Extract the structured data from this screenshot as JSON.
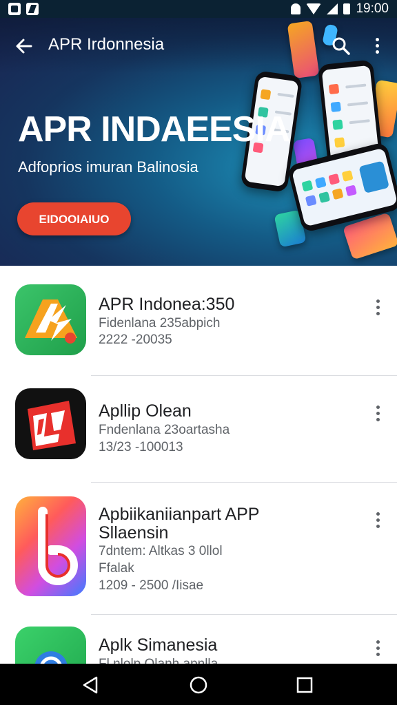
{
  "status_bar": {
    "time": "19:00"
  },
  "app_bar": {
    "title": "APR Irdonnesia"
  },
  "hero": {
    "title": "APR INDAEESIA",
    "subtitle": "Adfoprios imuran Balinosia",
    "button_label": "EIDOOIAIUO"
  },
  "apps": [
    {
      "title": "APR Indonea:350",
      "line1": "Fidenlana 235abpich",
      "line2": "2222 -20035"
    },
    {
      "title": "Apllip Olean",
      "line1": "Fndenlana 23oartasha",
      "line2": "13/23 -100013"
    },
    {
      "title": "Apbiikaniianpart APP",
      "title2": "Sllaensin",
      "line1": "7dntem: Altkas 3 0llol",
      "line2": "Ffalak",
      "line3": "1209 - 2500 /Iisae"
    },
    {
      "title": "Aplk Simanesia",
      "line1": "Fl.nlolp.Olanh apnlla"
    }
  ],
  "colors": {
    "hero_button": "#e8452f",
    "status_bar": "#0b2233",
    "nav_bar": "#000000"
  }
}
